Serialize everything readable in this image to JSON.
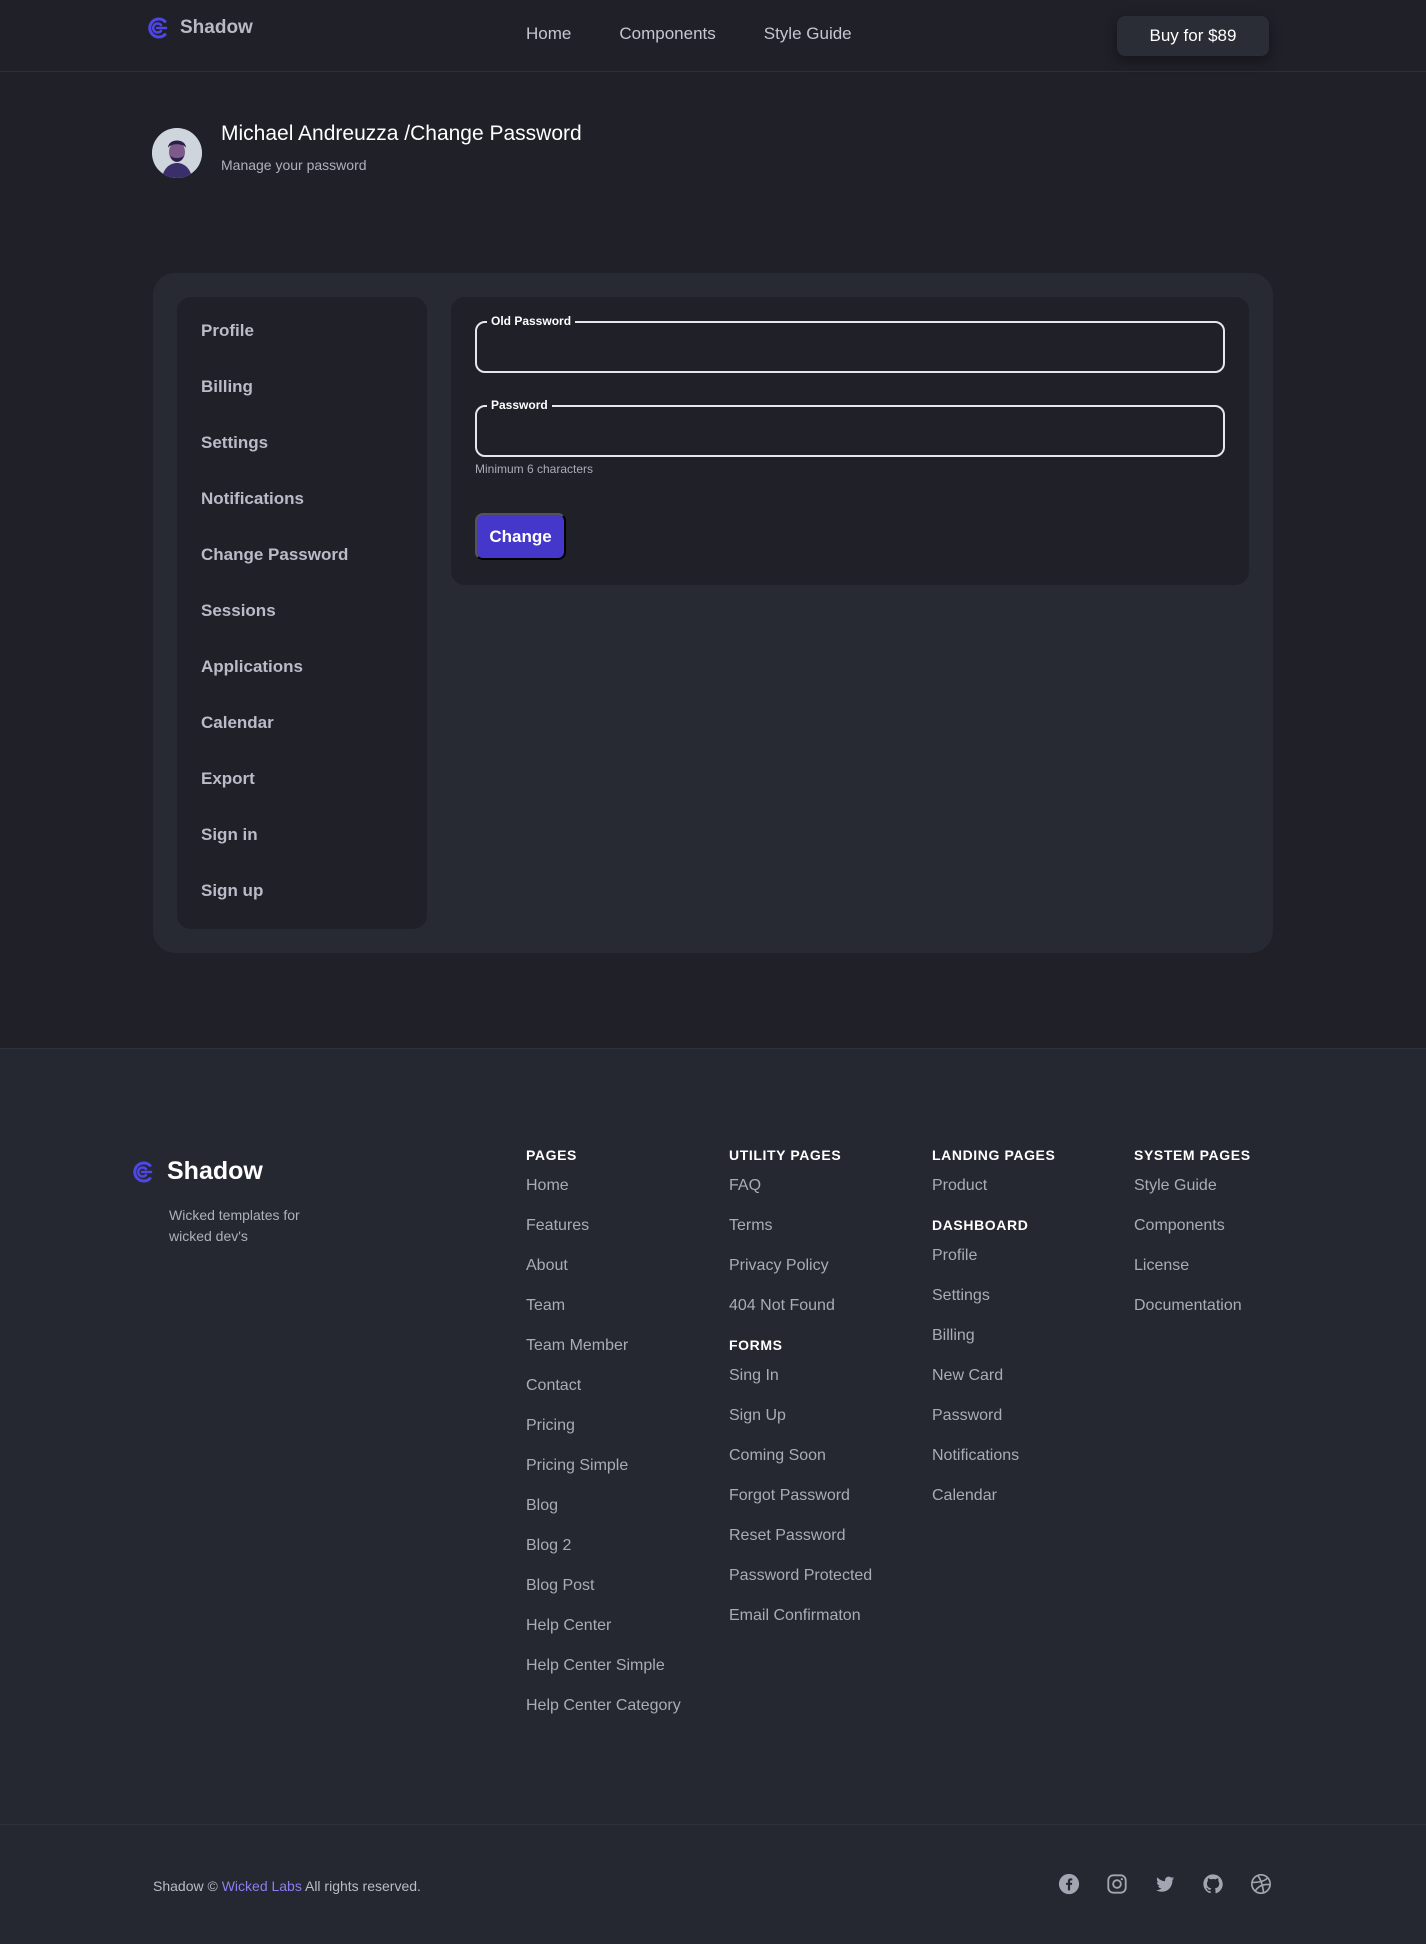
{
  "header": {
    "brand": "Shadow",
    "nav": [
      "Home",
      "Components",
      "Style Guide"
    ],
    "buy_label": "Buy for $89"
  },
  "page": {
    "title": "Michael Andreuzza /Change Password",
    "subtitle": "Manage your password"
  },
  "sidebar": {
    "items": [
      "Profile",
      "Billing",
      "Settings",
      "Notifications",
      "Change Password",
      "Sessions",
      "Applications",
      "Calendar",
      "Export",
      "Sign in",
      "Sign up"
    ]
  },
  "form": {
    "old_password_label": "Old Password",
    "old_password_value": "",
    "password_label": "Password",
    "password_value": "",
    "hint": "Minimum 6 characters",
    "submit_label": "Change"
  },
  "footer": {
    "brand": "Shadow",
    "tagline": "Wicked templates for wicked dev's",
    "columns": {
      "pages": {
        "title": "PAGES",
        "links": [
          "Home",
          "Features",
          "About",
          "Team",
          "Team Member",
          "Contact",
          "Pricing",
          "Pricing Simple",
          "Blog",
          "Blog 2",
          "Blog Post",
          "Help Center",
          "Help Center Simple",
          "Help Center Category"
        ]
      },
      "utility": {
        "title": "UTILITY PAGES",
        "links": [
          "FAQ",
          "Terms",
          "Privacy Policy",
          "404 Not Found"
        ],
        "forms_title": "FORMS",
        "forms_links": [
          "Sing In",
          "Sign Up",
          "Coming Soon",
          "Forgot Password",
          "Reset Password",
          "Password Protected",
          "Email Confirmaton"
        ]
      },
      "landing": {
        "title": "LANDING PAGES",
        "links": [
          "Product"
        ],
        "dashboard_title": "DASHBOARD",
        "dashboard_links": [
          "Profile",
          "Settings",
          "Billing",
          "New Card",
          "Password",
          "Notifications",
          "Calendar"
        ]
      },
      "system": {
        "title": "SYSTEM PAGES",
        "links": [
          "Style Guide",
          "Components",
          "License",
          "Documentation"
        ]
      }
    },
    "copyright_prefix": "Shadow ©",
    "copyright_link": "Wicked Labs",
    "copyright_suffix": "All rights reserved.",
    "socials": [
      "facebook-icon",
      "instagram-icon",
      "twitter-icon",
      "github-icon",
      "dribbble-icon"
    ]
  },
  "colors": {
    "background": "#1f2028",
    "panel": "#272933",
    "accent": "#4537c9",
    "link_accent": "#8b7ff0"
  }
}
